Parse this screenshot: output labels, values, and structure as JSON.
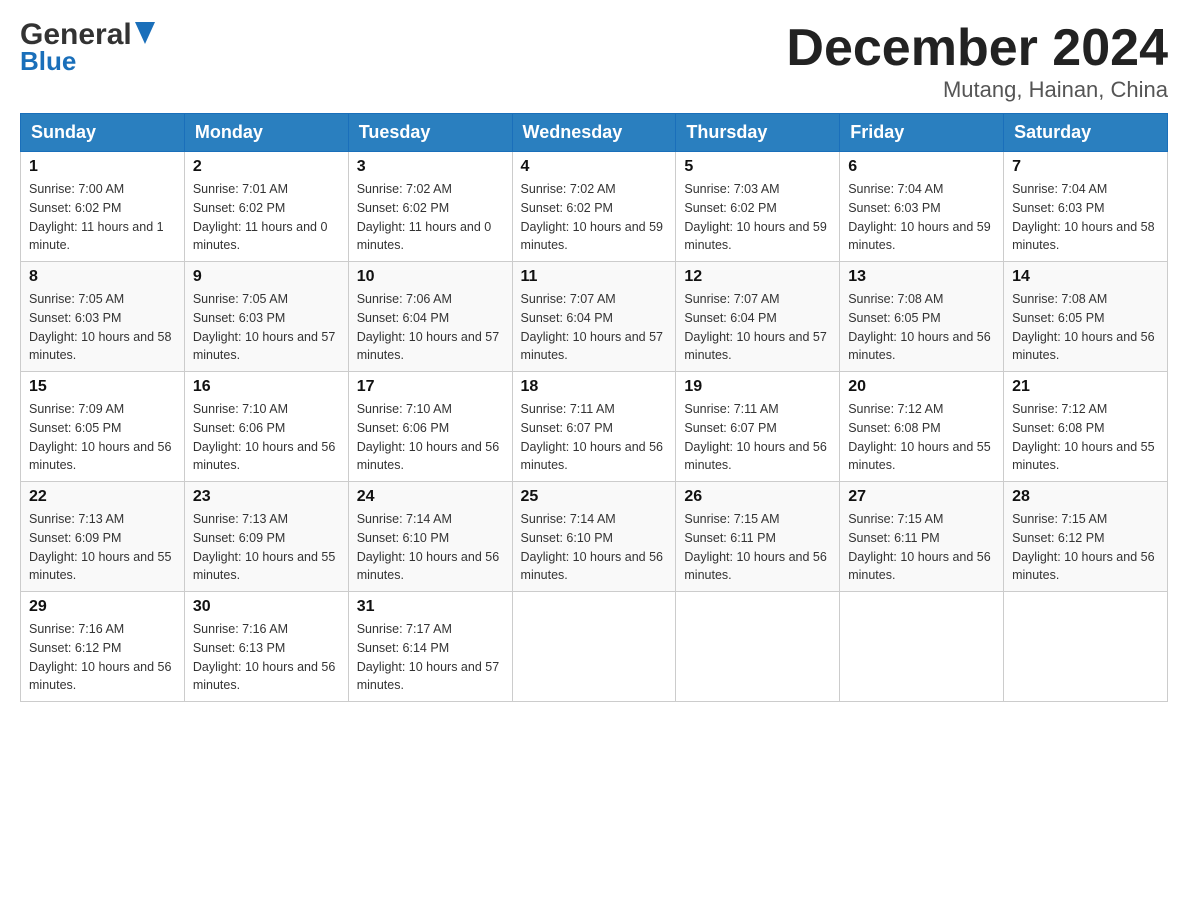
{
  "header": {
    "logo_general": "General",
    "logo_blue": "Blue",
    "month_title": "December 2024",
    "location": "Mutang, Hainan, China"
  },
  "days_of_week": [
    "Sunday",
    "Monday",
    "Tuesday",
    "Wednesday",
    "Thursday",
    "Friday",
    "Saturday"
  ],
  "weeks": [
    [
      {
        "day": "1",
        "sunrise": "7:00 AM",
        "sunset": "6:02 PM",
        "daylight": "11 hours and 1 minute."
      },
      {
        "day": "2",
        "sunrise": "7:01 AM",
        "sunset": "6:02 PM",
        "daylight": "11 hours and 0 minutes."
      },
      {
        "day": "3",
        "sunrise": "7:02 AM",
        "sunset": "6:02 PM",
        "daylight": "11 hours and 0 minutes."
      },
      {
        "day": "4",
        "sunrise": "7:02 AM",
        "sunset": "6:02 PM",
        "daylight": "10 hours and 59 minutes."
      },
      {
        "day": "5",
        "sunrise": "7:03 AM",
        "sunset": "6:02 PM",
        "daylight": "10 hours and 59 minutes."
      },
      {
        "day": "6",
        "sunrise": "7:04 AM",
        "sunset": "6:03 PM",
        "daylight": "10 hours and 59 minutes."
      },
      {
        "day": "7",
        "sunrise": "7:04 AM",
        "sunset": "6:03 PM",
        "daylight": "10 hours and 58 minutes."
      }
    ],
    [
      {
        "day": "8",
        "sunrise": "7:05 AM",
        "sunset": "6:03 PM",
        "daylight": "10 hours and 58 minutes."
      },
      {
        "day": "9",
        "sunrise": "7:05 AM",
        "sunset": "6:03 PM",
        "daylight": "10 hours and 57 minutes."
      },
      {
        "day": "10",
        "sunrise": "7:06 AM",
        "sunset": "6:04 PM",
        "daylight": "10 hours and 57 minutes."
      },
      {
        "day": "11",
        "sunrise": "7:07 AM",
        "sunset": "6:04 PM",
        "daylight": "10 hours and 57 minutes."
      },
      {
        "day": "12",
        "sunrise": "7:07 AM",
        "sunset": "6:04 PM",
        "daylight": "10 hours and 57 minutes."
      },
      {
        "day": "13",
        "sunrise": "7:08 AM",
        "sunset": "6:05 PM",
        "daylight": "10 hours and 56 minutes."
      },
      {
        "day": "14",
        "sunrise": "7:08 AM",
        "sunset": "6:05 PM",
        "daylight": "10 hours and 56 minutes."
      }
    ],
    [
      {
        "day": "15",
        "sunrise": "7:09 AM",
        "sunset": "6:05 PM",
        "daylight": "10 hours and 56 minutes."
      },
      {
        "day": "16",
        "sunrise": "7:10 AM",
        "sunset": "6:06 PM",
        "daylight": "10 hours and 56 minutes."
      },
      {
        "day": "17",
        "sunrise": "7:10 AM",
        "sunset": "6:06 PM",
        "daylight": "10 hours and 56 minutes."
      },
      {
        "day": "18",
        "sunrise": "7:11 AM",
        "sunset": "6:07 PM",
        "daylight": "10 hours and 56 minutes."
      },
      {
        "day": "19",
        "sunrise": "7:11 AM",
        "sunset": "6:07 PM",
        "daylight": "10 hours and 56 minutes."
      },
      {
        "day": "20",
        "sunrise": "7:12 AM",
        "sunset": "6:08 PM",
        "daylight": "10 hours and 55 minutes."
      },
      {
        "day": "21",
        "sunrise": "7:12 AM",
        "sunset": "6:08 PM",
        "daylight": "10 hours and 55 minutes."
      }
    ],
    [
      {
        "day": "22",
        "sunrise": "7:13 AM",
        "sunset": "6:09 PM",
        "daylight": "10 hours and 55 minutes."
      },
      {
        "day": "23",
        "sunrise": "7:13 AM",
        "sunset": "6:09 PM",
        "daylight": "10 hours and 55 minutes."
      },
      {
        "day": "24",
        "sunrise": "7:14 AM",
        "sunset": "6:10 PM",
        "daylight": "10 hours and 56 minutes."
      },
      {
        "day": "25",
        "sunrise": "7:14 AM",
        "sunset": "6:10 PM",
        "daylight": "10 hours and 56 minutes."
      },
      {
        "day": "26",
        "sunrise": "7:15 AM",
        "sunset": "6:11 PM",
        "daylight": "10 hours and 56 minutes."
      },
      {
        "day": "27",
        "sunrise": "7:15 AM",
        "sunset": "6:11 PM",
        "daylight": "10 hours and 56 minutes."
      },
      {
        "day": "28",
        "sunrise": "7:15 AM",
        "sunset": "6:12 PM",
        "daylight": "10 hours and 56 minutes."
      }
    ],
    [
      {
        "day": "29",
        "sunrise": "7:16 AM",
        "sunset": "6:12 PM",
        "daylight": "10 hours and 56 minutes."
      },
      {
        "day": "30",
        "sunrise": "7:16 AM",
        "sunset": "6:13 PM",
        "daylight": "10 hours and 56 minutes."
      },
      {
        "day": "31",
        "sunrise": "7:17 AM",
        "sunset": "6:14 PM",
        "daylight": "10 hours and 57 minutes."
      },
      null,
      null,
      null,
      null
    ]
  ],
  "labels": {
    "sunrise": "Sunrise:",
    "sunset": "Sunset:",
    "daylight": "Daylight:"
  }
}
